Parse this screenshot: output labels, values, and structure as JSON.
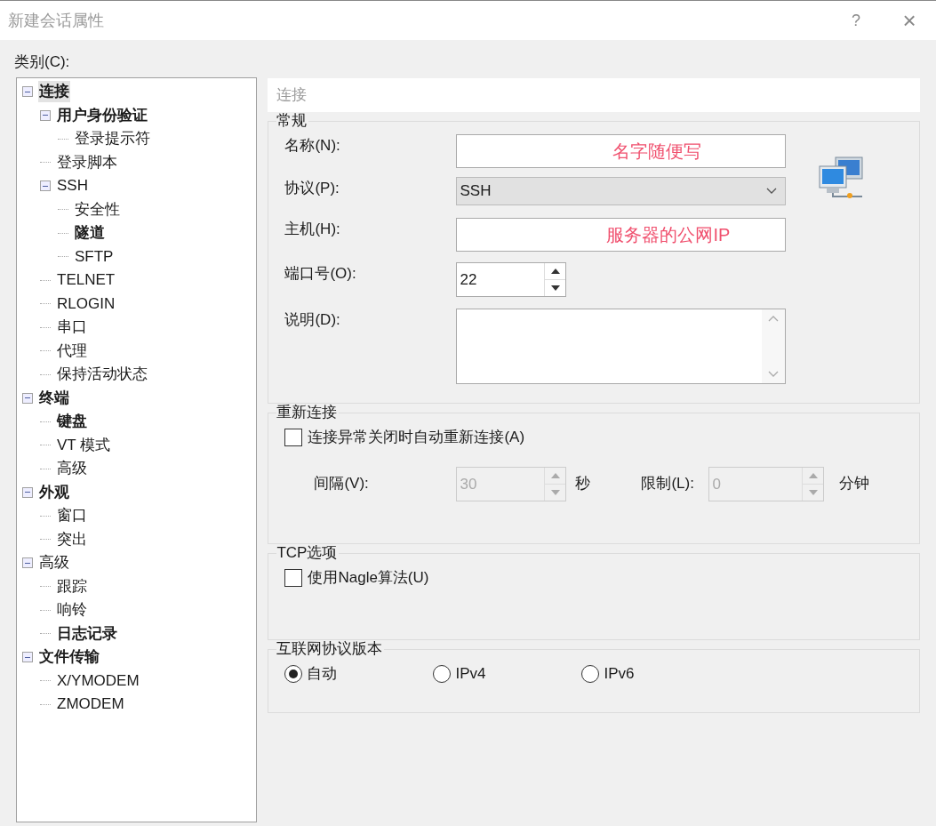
{
  "window": {
    "title": "新建会话属性",
    "help": "?",
    "close": "×"
  },
  "category_label": "类别(C):",
  "tree": [
    {
      "label": "连接",
      "bold": true,
      "selected": true,
      "expanded": true,
      "children": [
        {
          "label": "用户身份验证",
          "bold": true,
          "selected": false,
          "expanded": true,
          "children": [
            {
              "label": "登录提示符",
              "bold": false,
              "selected": false
            }
          ]
        },
        {
          "label": "登录脚本",
          "bold": false,
          "selected": false
        },
        {
          "label": "SSH",
          "bold": false,
          "selected": false,
          "expanded": true,
          "children": [
            {
              "label": "安全性",
              "bold": false,
              "selected": false
            },
            {
              "label": "隧道",
              "bold": true,
              "selected": false
            },
            {
              "label": "SFTP",
              "bold": false,
              "selected": false
            }
          ]
        },
        {
          "label": "TELNET",
          "bold": false,
          "selected": false
        },
        {
          "label": "RLOGIN",
          "bold": false,
          "selected": false
        },
        {
          "label": "串口",
          "bold": false,
          "selected": false
        },
        {
          "label": "代理",
          "bold": false,
          "selected": false
        },
        {
          "label": "保持活动状态",
          "bold": false,
          "selected": false
        }
      ]
    },
    {
      "label": "终端",
      "bold": true,
      "selected": false,
      "expanded": true,
      "children": [
        {
          "label": "键盘",
          "bold": true,
          "selected": false
        },
        {
          "label": "VT 模式",
          "bold": false,
          "selected": false
        },
        {
          "label": "高级",
          "bold": false,
          "selected": false
        }
      ]
    },
    {
      "label": "外观",
      "bold": true,
      "selected": false,
      "expanded": true,
      "children": [
        {
          "label": "窗口",
          "bold": false,
          "selected": false
        },
        {
          "label": "突出",
          "bold": false,
          "selected": false
        }
      ]
    },
    {
      "label": "高级",
      "bold": false,
      "selected": false,
      "expanded": true,
      "children": [
        {
          "label": "跟踪",
          "bold": false,
          "selected": false
        },
        {
          "label": "响铃",
          "bold": false,
          "selected": false
        },
        {
          "label": "日志记录",
          "bold": true,
          "selected": false
        }
      ]
    },
    {
      "label": "文件传输",
      "bold": true,
      "selected": false,
      "expanded": true,
      "children": [
        {
          "label": "X/YMODEM",
          "bold": false,
          "selected": false
        },
        {
          "label": "ZMODEM",
          "bold": false,
          "selected": false
        }
      ]
    }
  ],
  "panel_title": "连接",
  "general": {
    "title": "常规",
    "name": {
      "label": "名称(N):",
      "value": "名字随便写"
    },
    "protocol": {
      "label": "协议(P):",
      "value": "SSH"
    },
    "host": {
      "label": "主机(H):",
      "value": "服务器的公网IP"
    },
    "port": {
      "label": "端口号(O):",
      "value": "22"
    },
    "description": {
      "label": "说明(D):"
    }
  },
  "reconnect": {
    "title": "重新连接",
    "checkbox": {
      "label": "连接异常关闭时自动重新连接(A)",
      "checked": false
    },
    "interval": {
      "label": "间隔(V):",
      "value": "30",
      "unit": "秒",
      "disabled": true
    },
    "limit": {
      "label": "限制(L):",
      "value": "0",
      "unit": "分钟",
      "disabled": true
    }
  },
  "tcp": {
    "title": "TCP选项",
    "checkbox": {
      "label": "使用Nagle算法(U)",
      "checked": false
    }
  },
  "ip_version": {
    "title": "互联网协议版本",
    "options": [
      {
        "label": "自动",
        "selected": true
      },
      {
        "label": "IPv4",
        "selected": false
      },
      {
        "label": "IPv6",
        "selected": false
      }
    ]
  }
}
